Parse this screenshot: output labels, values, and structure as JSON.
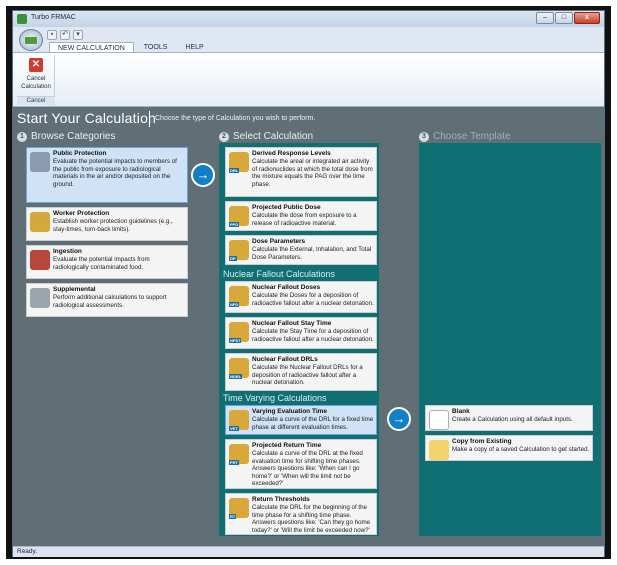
{
  "window": {
    "title": "Turbo FRMAC",
    "controls": [
      "–",
      "□",
      "x"
    ]
  },
  "quick_access": [
    "save-icon",
    "undo-icon"
  ],
  "menu": {
    "tabs": [
      "NEW CALCULATION",
      "TOOLS",
      "HELP"
    ]
  },
  "ribbon": {
    "cancel_label": "Cancel\nCalculation",
    "group_label": "Cancel"
  },
  "main": {
    "heading": "Start Your Calculation",
    "subheading": "Choose the type of Calculation you wish to perform.",
    "columns": [
      {
        "number": "1",
        "title": "Browse Categories"
      },
      {
        "number": "2",
        "title": "Select Calculation"
      },
      {
        "number": "3",
        "title": "Choose Template"
      }
    ],
    "categories": [
      {
        "title": "Public Protection",
        "desc": "Evaluate the potential impacts to members of the public from exposure to radiological materials in the air and/or deposited on the ground.",
        "icon": "person-shield-icon",
        "selected": true
      },
      {
        "title": "Worker Protection",
        "desc": "Establish worker protection guidelines (e.g., stay-times, turn-back limits).",
        "icon": "worker-icon",
        "selected": false
      },
      {
        "title": "Ingestion",
        "desc": "Evaluate the potential impacts from radiologically contaminated food.",
        "icon": "food-icon",
        "selected": false
      },
      {
        "title": "Supplemental",
        "desc": "Perform additional calculations to support radiological assessments.",
        "icon": "calculator-icon",
        "selected": false
      }
    ],
    "calc_groups": [
      {
        "heading": "",
        "items": [
          {
            "title": "Derived Response Levels",
            "desc": "Calculate the areal or integrated air activity of radionuclides at which the total dose from the mixture equals the PAG over the time phase.",
            "tag": "DRL"
          },
          {
            "title": "Projected Public Dose",
            "desc": "Calculate the dose from exposure to a release of radioactive material.",
            "tag": "PPD"
          },
          {
            "title": "Dose Parameters",
            "desc": "Calculate the External, Inhalation, and Total Dose Parameters.",
            "tag": "DP"
          }
        ]
      },
      {
        "heading": "Nuclear Fallout Calculations",
        "items": [
          {
            "title": "Nuclear Fallout Doses",
            "desc": "Calculate the Doses for a deposition of radioactive fallout after a nuclear detonation.",
            "tag": "NFD"
          },
          {
            "title": "Nuclear Fallout Stay Time",
            "desc": "Calculate the Stay Time for a deposition of radioactive fallout after a nuclear detonation.",
            "tag": "NFST"
          },
          {
            "title": "Nuclear Fallout DRLs",
            "desc": "Calculate the Nuclear Fallout DRLs for a deposition of radioactive fallout after a nuclear detonation.",
            "tag": "NDRL"
          }
        ]
      },
      {
        "heading": "Time Varying Calculations",
        "items": [
          {
            "title": "Varying Evaluation Time",
            "desc": "Calculate a curve of the DRL for a fixed time phase at different evaluation times.",
            "tag": "VET",
            "selected": true
          },
          {
            "title": "Projected Return Time",
            "desc": "Calculate a curve of the DRL at the fixed evaluation time for shifting time phases. Answers questions like: 'When can I go home?' or 'When will the limit not be exceeded?'",
            "tag": "PRT"
          },
          {
            "title": "Return Thresholds",
            "desc": "Calculate the DRL for the beginning of the time phase for a shifting time phase. Answers questions like: 'Can they go home today?' or 'Will the limit be exceeded now?'",
            "tag": "RT"
          }
        ]
      }
    ],
    "templates": [
      {
        "title": "Blank",
        "desc": "Create a Calculation using all default inputs.",
        "icon": "blank-doc-icon"
      },
      {
        "title": "Copy from Existing",
        "desc": "Make a copy of a saved Calculation to get started.",
        "icon": "copy-doc-icon"
      }
    ]
  },
  "status": {
    "text": "Ready."
  },
  "colors": {
    "teal": "#0f6f72",
    "selected": "#cfe2f6",
    "arrow": "#1280c6",
    "bg": "#5f6f75"
  }
}
